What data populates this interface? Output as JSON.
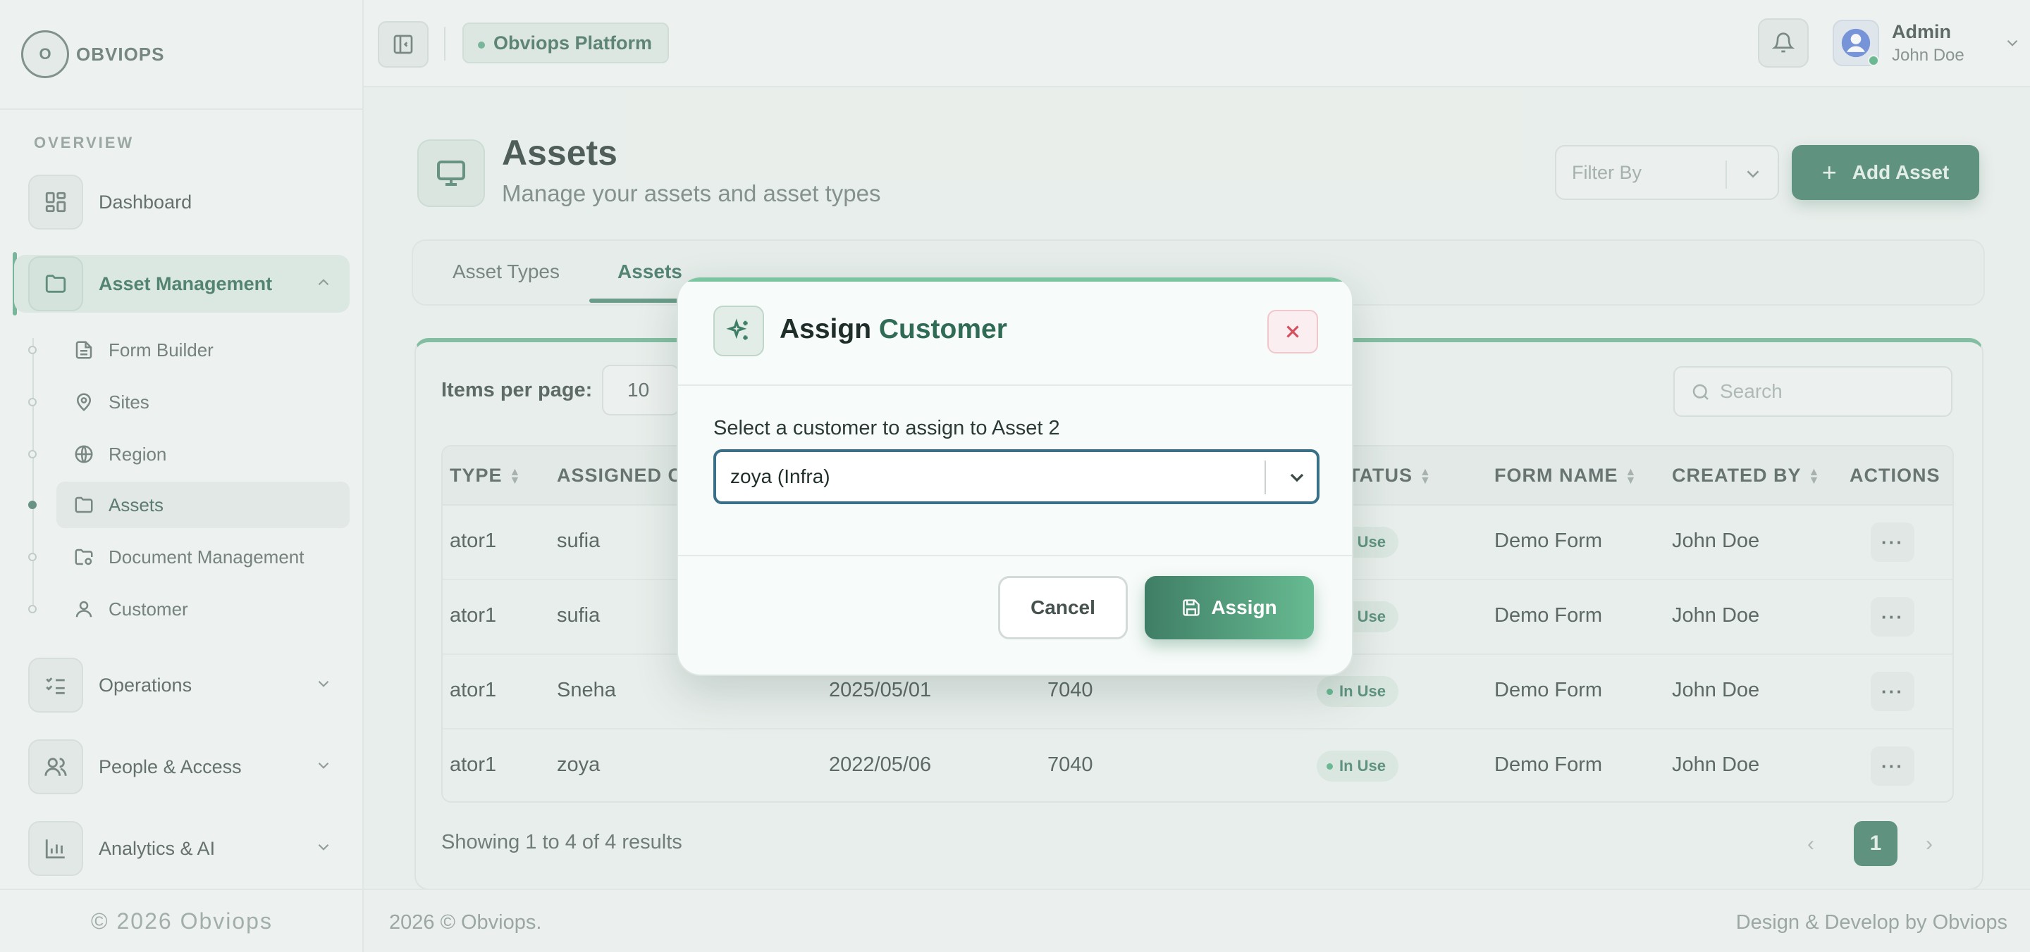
{
  "brand": {
    "logo_text": "OBVIOPS",
    "logo_mark": "O"
  },
  "sidebar": {
    "section_label": "OVERVIEW",
    "items": [
      {
        "label": "Dashboard",
        "icon": "dashboard-icon"
      },
      {
        "label": "Asset Management",
        "icon": "folder-icon"
      },
      {
        "label": "Operations",
        "icon": "list-check-icon"
      },
      {
        "label": "People & Access",
        "icon": "users-icon"
      },
      {
        "label": "Analytics & AI",
        "icon": "bar-chart-icon"
      }
    ],
    "sub_items": [
      {
        "label": "Form Builder",
        "icon": "file-text-icon"
      },
      {
        "label": "Sites",
        "icon": "map-pin-icon"
      },
      {
        "label": "Region",
        "icon": "globe-icon"
      },
      {
        "label": "Assets",
        "icon": "folder-icon"
      },
      {
        "label": "Document Management",
        "icon": "folder-settings-icon"
      },
      {
        "label": "Customer",
        "icon": "user-icon"
      }
    ],
    "footer": "© 2026 Obviops"
  },
  "topbar": {
    "platform_chip": "Obviops Platform",
    "user_role": "Admin",
    "user_name": "John Doe"
  },
  "page": {
    "title": "Assets",
    "subtitle": "Manage your assets and asset types",
    "filter_placeholder": "Filter By",
    "add_button": "Add Asset",
    "add_button_plus": "+",
    "tabs": [
      {
        "label": "Asset Types"
      },
      {
        "label": "Assets"
      }
    ],
    "active_tab": "Assets",
    "items_per_page_label": "Items per page:",
    "items_per_page_value": "10",
    "search_placeholder": "Search"
  },
  "table": {
    "columns": [
      "TYPE",
      "ASSIGNED C",
      "STATUS",
      "FORM NAME",
      "CREATED BY",
      "ACTIONS"
    ],
    "rows": [
      {
        "type": "ator1",
        "assigned": "sufia",
        "date": "",
        "number": "",
        "status": "In Use",
        "form": "Demo Form",
        "created_by": "John Doe"
      },
      {
        "type": "ator1",
        "assigned": "sufia",
        "date": "",
        "number": "",
        "status": "In Use",
        "form": "Demo Form",
        "created_by": "John Doe"
      },
      {
        "type": "ator1",
        "assigned": "Sneha",
        "date": "2025/05/01",
        "number": "7040",
        "status": "In Use",
        "form": "Demo Form",
        "created_by": "John Doe"
      },
      {
        "type": "ator1",
        "assigned": "zoya",
        "date": "2022/05/06",
        "number": "7040",
        "status": "In Use",
        "form": "Demo Form",
        "created_by": "John Doe"
      }
    ],
    "actions_glyph": "···",
    "showing_text": "Showing 1 to 4 of 4 results",
    "current_page": "1",
    "prev_glyph": "‹",
    "next_glyph": "›"
  },
  "footer": {
    "left": "2026 © Obviops.",
    "right": "Design & Develop by Obviops"
  },
  "modal": {
    "title_main": "Assign",
    "title_accent": "Customer",
    "label": "Select a customer to assign to Asset 2",
    "selected_value": "zoya (Infra)",
    "cancel_label": "Cancel",
    "assign_label": "Assign"
  },
  "colors": {
    "brand_green": "#3e7e66",
    "accent_green": "#67bb92",
    "focus_border": "#3a6f88",
    "close_red": "#d4505f"
  }
}
